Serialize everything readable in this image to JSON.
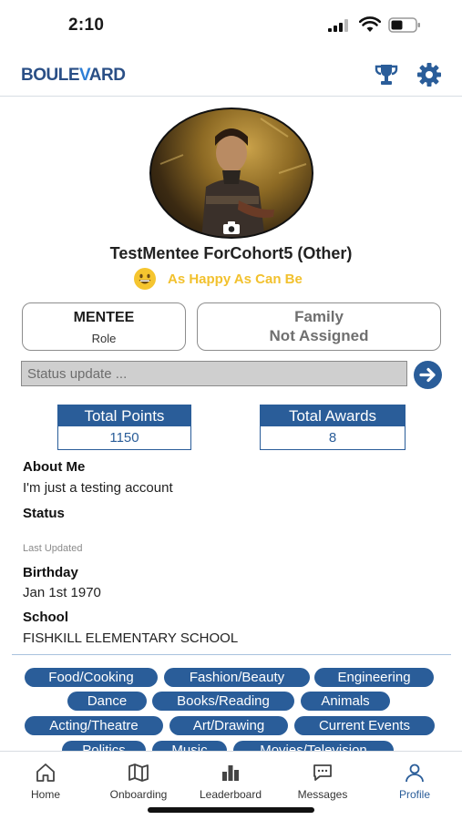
{
  "status_bar": {
    "time": "2:10"
  },
  "header": {
    "logo_part1": "BOULE",
    "logo_part2": "V",
    "logo_part3": "ARD",
    "icons": [
      "trophy-icon",
      "gear-icon"
    ]
  },
  "profile": {
    "name": "TestMentee ForCohort5 (Other)",
    "mood_text": "As Happy As Can Be",
    "role_title": "MENTEE",
    "role_label": "Role",
    "family_line1": "Family",
    "family_line2": "Not Assigned"
  },
  "status_update": {
    "placeholder": "Status update ..."
  },
  "stats": {
    "points_label": "Total Points",
    "points_value": "1150",
    "awards_label": "Total Awards",
    "awards_value": "8"
  },
  "details": {
    "about_label": "About Me",
    "about_value": "I'm just a testing account",
    "status_label": "Status",
    "last_updated_label": "Last Updated",
    "birthday_label": "Birthday",
    "birthday_value": "Jan 1st 1970",
    "school_label": "School",
    "school_value": "FISHKILL ELEMENTARY SCHOOL"
  },
  "interests": [
    "Food/Cooking",
    "Fashion/Beauty",
    "Engineering",
    "Dance",
    "Books/Reading",
    "Animals",
    "Acting/Theatre",
    "Art/Drawing",
    "Current Events",
    "Politics",
    "Music",
    "Movies/Television"
  ],
  "tabs": [
    {
      "label": "Home",
      "icon": "home-icon"
    },
    {
      "label": "Onboarding",
      "icon": "map-icon"
    },
    {
      "label": "Leaderboard",
      "icon": "bar-chart-icon"
    },
    {
      "label": "Messages",
      "icon": "messages-icon"
    },
    {
      "label": "Profile",
      "icon": "person-icon"
    }
  ],
  "colors": {
    "primary": "#2a5d99",
    "mood": "#f2c12e"
  }
}
